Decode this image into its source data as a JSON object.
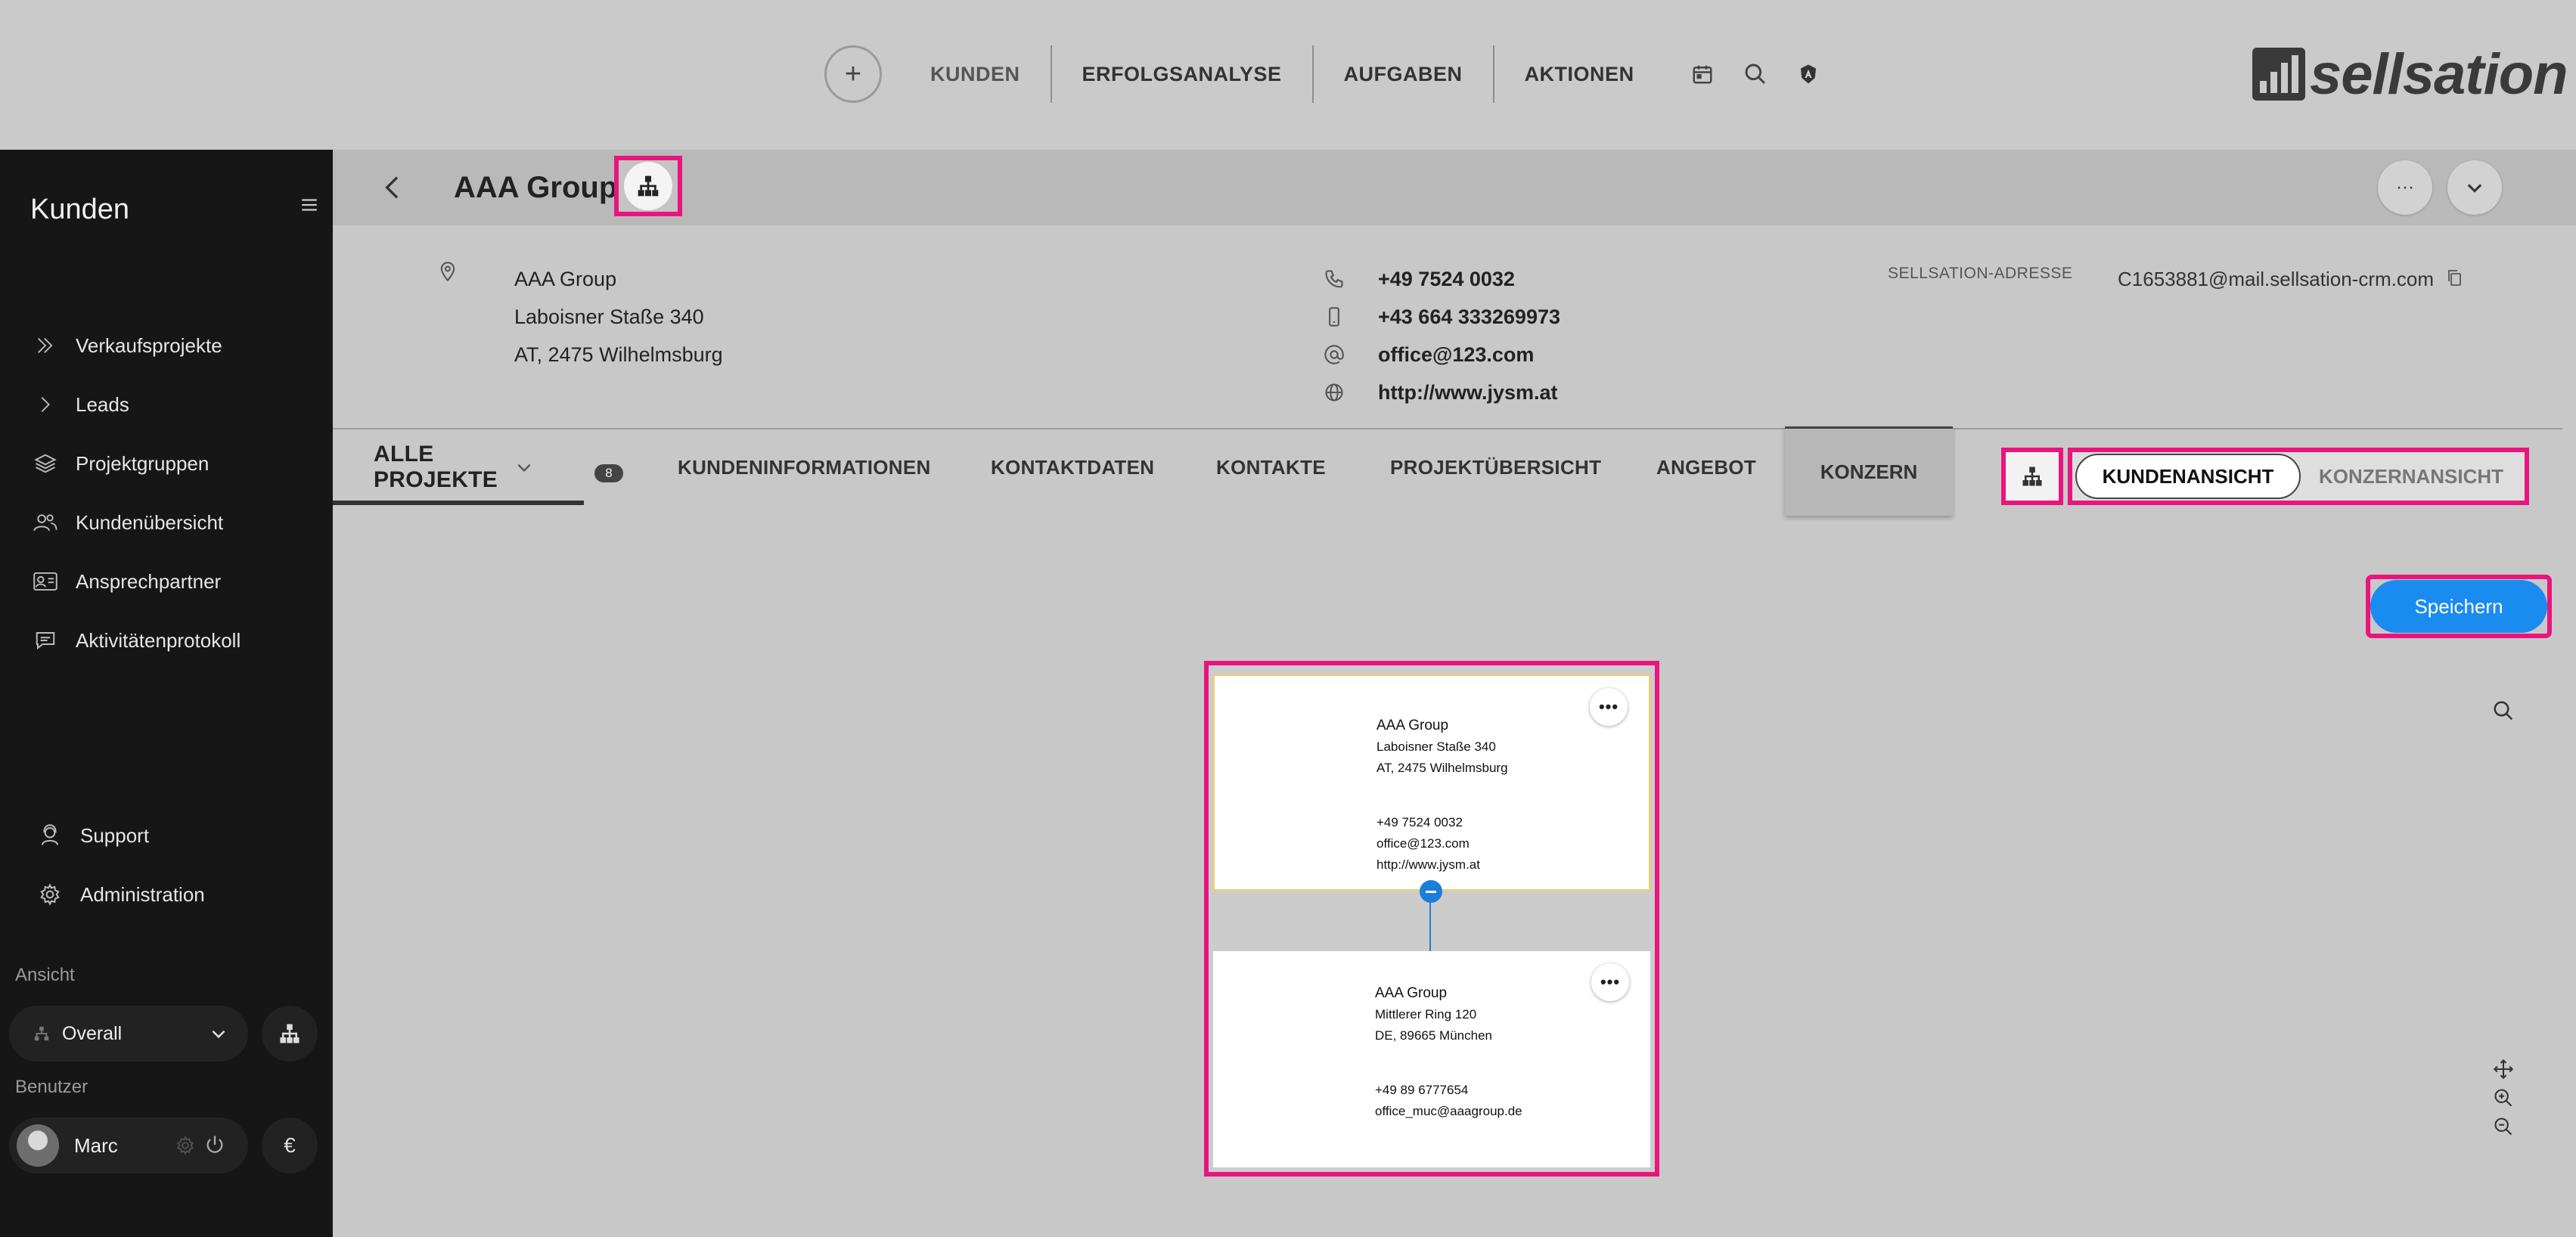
{
  "nav": {
    "items": [
      "KUNDEN",
      "ERFOLGSANALYSE",
      "AUFGABEN",
      "AKTIONEN"
    ],
    "plus_label": "+"
  },
  "logo": {
    "text": "sellsation"
  },
  "sidebar": {
    "title": "Kunden",
    "items": [
      "Verkaufsprojekte",
      "Leads",
      "Projektgruppen",
      "Kundenübersicht",
      "Ansprechpartner",
      "Aktivitätenprotokoll"
    ],
    "bottom_items": [
      "Support",
      "Administration"
    ],
    "view_label": "Ansicht",
    "view_value": "Overall",
    "user_label": "Benutzer",
    "user_name": "Marc",
    "currency": "€"
  },
  "header": {
    "title": "AAA Group",
    "more_label": "···"
  },
  "customer": {
    "address_lines": [
      "AAA Group",
      "Laboisner Staße 340",
      "AT, 2475 Wilhelmsburg"
    ],
    "phone": "+49 7524 0032",
    "mobile": "+43 664 333269973",
    "email": "office@123.com",
    "website": "http://www.jysm.at",
    "sellsation_label": "SELLSATION-ADRESSE",
    "sellsation_value": "C1653881@mail.sellsation-crm.com"
  },
  "tabs": {
    "all_projects": "ALLE PROJEKTE",
    "badge": "8",
    "items": [
      "KUNDENINFORMATIONEN",
      "KONTAKTDATEN",
      "KONTAKTE",
      "PROJEKTÜBERSICHT",
      "ANGEBOT"
    ],
    "konzern": "KONZERN"
  },
  "view_toggle": {
    "on": "KUNDENANSICHT",
    "off": "KONZERNANSICHT"
  },
  "save_label": "Speichern",
  "org_chart": {
    "cards": [
      {
        "name": "AAA Group",
        "street": "Laboisner Staße 340",
        "city": "AT, 2475 Wilhelmsburg",
        "phone": "+49 7524 0032",
        "email": "office@123.com",
        "web": "http://www.jysm.at",
        "dots": "•••"
      },
      {
        "name": "AAA Group",
        "street": "Mittlerer Ring 120",
        "city": "DE, 89665 München",
        "phone": "+49 89 6777654",
        "email": "office_muc@aaagroup.de",
        "dots": "•••"
      }
    ]
  },
  "colors": {
    "highlight": "#e8157d",
    "primary": "#1a8cf0",
    "sidebar": "#161616",
    "connector": "#1a7ed8"
  },
  "icons": {
    "calendar": "calendar-icon",
    "search": "search-icon",
    "shield": "shield-icon",
    "org": "org-chart-icon"
  }
}
